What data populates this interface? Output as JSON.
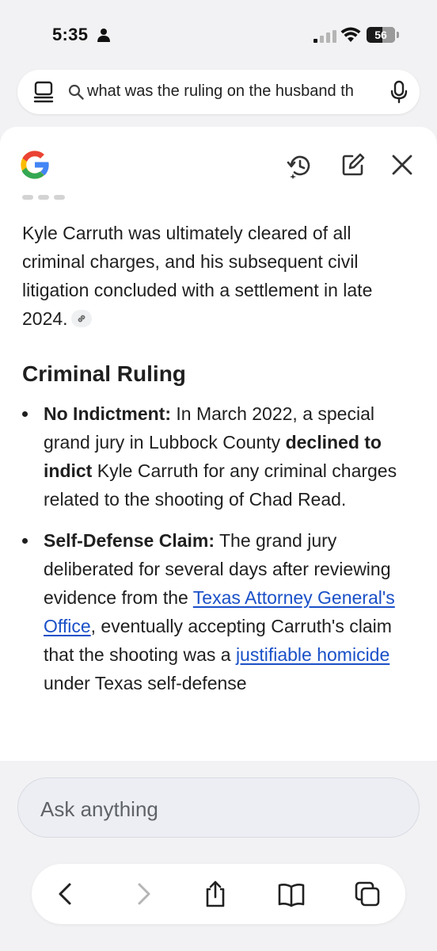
{
  "status_bar": {
    "time": "5:35",
    "battery_level": "56",
    "icons": [
      "person-icon",
      "signal-icon",
      "wifi-icon",
      "battery-icon"
    ]
  },
  "search": {
    "query": "what was the ruling on the husband th",
    "icons": [
      "tabs-icon",
      "search-icon",
      "microphone-icon"
    ]
  },
  "header": {
    "icons": [
      "google-logo",
      "history-icon",
      "edit-icon",
      "close-icon"
    ]
  },
  "answer": {
    "intro": "Kyle Carruth was ultimately cleared of all criminal charges, and his subsequent civil litigation concluded with a settlement in late 2024.",
    "section_title": "Criminal Ruling",
    "bullets": [
      {
        "label": "No Indictment:",
        "text1": " In March 2022, a special grand jury in Lubbock County ",
        "bold2": "declined to indict",
        "text2": " Kyle Carruth for any criminal charges related to the shooting of Chad Read."
      },
      {
        "label": "Self-Defense Claim:",
        "text1": " The grand jury deliberated for several days after reviewing evidence from the ",
        "link1": "Texas Attorney General's Office",
        "text2": ", eventually accepting Carruth's claim that the shooting was a ",
        "link2": "justifiable homicide",
        "text3": " under Texas self-defense"
      }
    ]
  },
  "ask": {
    "placeholder": "Ask anything"
  },
  "toolbar": {
    "icons": [
      "back-icon",
      "forward-icon",
      "share-icon",
      "bookmarks-icon",
      "tabs-icon"
    ]
  },
  "colors": {
    "link": "#1a50c8",
    "background": "#f2f2f4",
    "google_blue": "#4285F4",
    "google_red": "#EA4335",
    "google_yellow": "#FBBC05",
    "google_green": "#34A853"
  }
}
